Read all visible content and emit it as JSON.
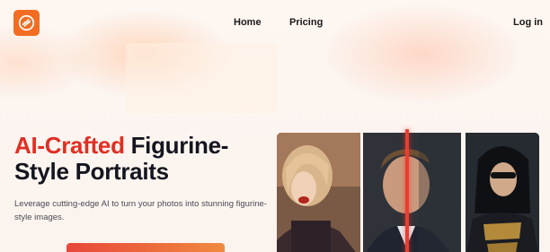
{
  "nav": {
    "home_label": "Home",
    "pricing_label": "Pricing",
    "login_label": "Log in",
    "logo_icon": "link-chain-icon"
  },
  "hero": {
    "title_accent": "AI-Crafted",
    "title_rest_line1": " Figurine-",
    "title_line2": "Style Portraits",
    "description": "Leverage cutting-edge AI to turn your photos into stunning figurine-style images."
  },
  "gallery": {
    "photos": [
      "portrait-photo",
      "comparison-photo",
      "figurine-photo"
    ],
    "divider_color": "#ef3b2d"
  },
  "colors": {
    "brand": "#f26d21",
    "accent": "#e02f23",
    "cta_start": "#e8473a",
    "cta_end": "#f08a3e"
  }
}
